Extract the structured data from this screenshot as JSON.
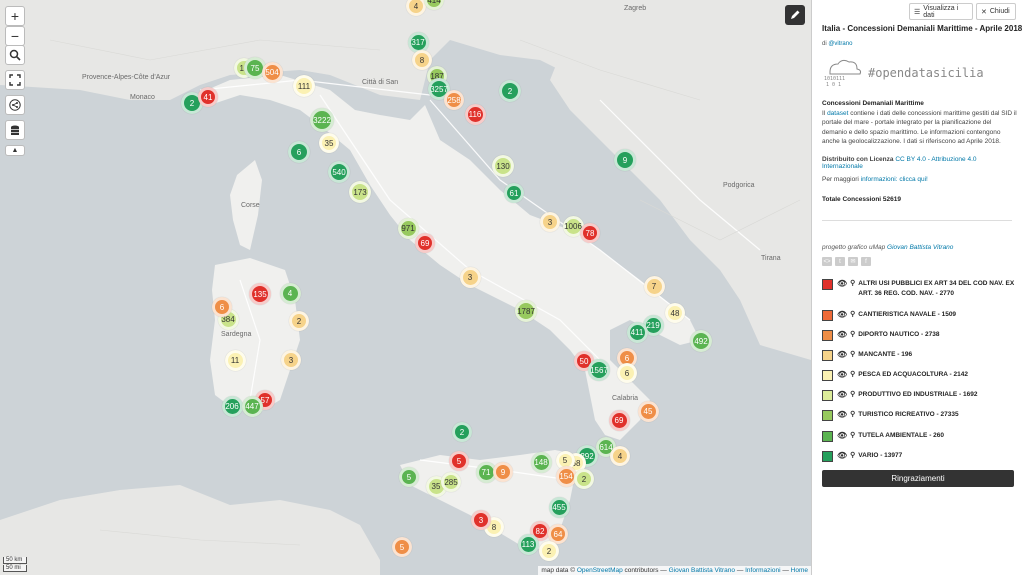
{
  "map": {
    "place_labels": [
      {
        "text": "Monaco"
      },
      {
        "text": "Città di San"
      },
      {
        "text": "Provence-Alpes-Côte d'Azur"
      },
      {
        "text": "Corse"
      },
      {
        "text": "Sardegna"
      },
      {
        "text": "Calabria"
      },
      {
        "text": "Podgorica"
      },
      {
        "text": "Tirana"
      },
      {
        "text": "Zagreb"
      }
    ],
    "clusters": [
      {
        "label": "4",
        "color": "#f6d38a",
        "dark": true
      },
      {
        "label": "414",
        "color": "#97c95e",
        "dark": true
      },
      {
        "label": "317",
        "color": "#25a05c"
      },
      {
        "label": "8",
        "color": "#f6d38a",
        "dark": true
      },
      {
        "label": "187",
        "color": "#97c95e",
        "dark": true
      },
      {
        "label": "3257",
        "color": "#25a05c"
      },
      {
        "label": "258",
        "color": "#ef8e47"
      },
      {
        "label": "116",
        "color": "#e0312b"
      },
      {
        "label": "2",
        "color": "#25a05c"
      },
      {
        "label": "9",
        "color": "#25a05c"
      },
      {
        "label": "10",
        "color": "#c9e38a",
        "dark": true
      },
      {
        "label": "75",
        "color": "#5bb451"
      },
      {
        "label": "504",
        "color": "#ef8e47"
      },
      {
        "label": "111",
        "color": "#fbf1b3",
        "dark": true
      },
      {
        "label": "2",
        "color": "#25a05c"
      },
      {
        "label": "41",
        "color": "#e0312b"
      },
      {
        "label": "3222",
        "color": "#5bb451"
      },
      {
        "label": "6",
        "color": "#25a05c"
      },
      {
        "label": "35",
        "color": "#fbf1b3",
        "dark": true
      },
      {
        "label": "540",
        "color": "#25a05c"
      },
      {
        "label": "173",
        "color": "#c9e38a",
        "dark": true
      },
      {
        "label": "130",
        "color": "#c9e38a",
        "dark": true
      },
      {
        "label": "61",
        "color": "#25a05c"
      },
      {
        "label": "3",
        "color": "#f6d38a",
        "dark": true
      },
      {
        "label": "1006",
        "color": "#c9e38a",
        "dark": true
      },
      {
        "label": "78",
        "color": "#e0312b"
      },
      {
        "label": "971",
        "color": "#97c95e",
        "dark": true
      },
      {
        "label": "69",
        "color": "#e0312b"
      },
      {
        "label": "3",
        "color": "#f6d38a",
        "dark": true
      },
      {
        "label": "1787",
        "color": "#97c95e",
        "dark": true
      },
      {
        "label": "7",
        "color": "#f6d38a",
        "dark": true
      },
      {
        "label": "219",
        "color": "#25a05c"
      },
      {
        "label": "48",
        "color": "#fbf1b3",
        "dark": true
      },
      {
        "label": "411",
        "color": "#25a05c"
      },
      {
        "label": "492",
        "color": "#5bb451"
      },
      {
        "label": "50",
        "color": "#e0312b"
      },
      {
        "label": "6",
        "color": "#ef8e47"
      },
      {
        "label": "1567",
        "color": "#25a05c"
      },
      {
        "label": "6",
        "color": "#fbf1b3",
        "dark": true
      },
      {
        "label": "45",
        "color": "#ef8e47"
      },
      {
        "label": "69",
        "color": "#e0312b"
      },
      {
        "label": "135",
        "color": "#e0312b"
      },
      {
        "label": "4",
        "color": "#5bb451"
      },
      {
        "label": "384",
        "color": "#c9e38a",
        "dark": true
      },
      {
        "label": "6",
        "color": "#ef8e47"
      },
      {
        "label": "2",
        "color": "#f6d38a",
        "dark": true
      },
      {
        "label": "11",
        "color": "#fbf1b3",
        "dark": true
      },
      {
        "label": "3",
        "color": "#f6d38a",
        "dark": true
      },
      {
        "label": "57",
        "color": "#e0312b"
      },
      {
        "label": "206",
        "color": "#25a05c"
      },
      {
        "label": "447",
        "color": "#5bb451"
      },
      {
        "label": "2",
        "color": "#25a05c"
      },
      {
        "label": "614",
        "color": "#5bb451"
      },
      {
        "label": "292",
        "color": "#25a05c"
      },
      {
        "label": "4",
        "color": "#f6d38a",
        "dark": true
      },
      {
        "label": "148",
        "color": "#5bb451"
      },
      {
        "label": "68",
        "color": "#fbf1b3",
        "dark": true
      },
      {
        "label": "5",
        "color": "#fbf1b3",
        "dark": true
      },
      {
        "label": "154",
        "color": "#ef8e47"
      },
      {
        "label": "2",
        "color": "#c9e38a",
        "dark": true
      },
      {
        "label": "71",
        "color": "#5bb451"
      },
      {
        "label": "9",
        "color": "#ef8e47"
      },
      {
        "label": "5",
        "color": "#5bb451"
      },
      {
        "label": "35",
        "color": "#c9e38a",
        "dark": true
      },
      {
        "label": "285",
        "color": "#c9e38a",
        "dark": true
      },
      {
        "label": "455",
        "color": "#25a05c"
      },
      {
        "label": "8",
        "color": "#fbf1b3",
        "dark": true
      },
      {
        "label": "3",
        "color": "#e0312b"
      },
      {
        "label": "82",
        "color": "#e0312b"
      },
      {
        "label": "64",
        "color": "#ef8e47"
      },
      {
        "label": "113",
        "color": "#25a05c"
      },
      {
        "label": "2",
        "color": "#fbf1b3",
        "dark": true
      },
      {
        "label": "5",
        "color": "#ef8e47"
      },
      {
        "label": "5",
        "color": "#e0312b"
      }
    ],
    "scale_labels": [
      "50 km",
      "50 mi"
    ],
    "attribution": {
      "prefix": "map data ©",
      "osm": "OpenStreetMap",
      "contrib": "contributors —",
      "author": "Giovan Battista Vitrano",
      "sep": "—",
      "info": "Informazioni",
      "home": "Home"
    }
  },
  "panel": {
    "view_data_btn": "Visualizza i dati",
    "close_btn": "Chiudi",
    "title": "Italia - Concessioni Demaniali Marittime - Aprile 2018",
    "by_prefix": "di",
    "by_user": "@vitrano",
    "logo_text": "#opendatasicilia",
    "desc_heading": "Concessioni Demaniali Marittime",
    "desc_p1": "Il",
    "desc_link": "dataset",
    "desc_p2": "contiene i dati delle concessioni marittime gestiti dal SID il portale del mare - portale integrato per la pianificazione del demanio e dello spazio marittimo. Le informazioni contengono anche la geolocalizzazione. I dati si riferiscono ad Aprile 2018.",
    "license_label": "Distribuito con Licenza",
    "license_link": "CC BY 4.0 - Attribuzione 4.0 Internazionale",
    "more_info_prefix": "Per maggiori",
    "more_info_link": "informazioni: clicca qui!",
    "total": "Totale Concessioni 52619",
    "credit_prefix": "progetto grafico uMap",
    "credit_link": "Giovan Battista Vitrano",
    "legend": [
      {
        "label": "ALTRI USI PUBBLICI EX ART 34 DEL COD NAV. EX ART. 36 REG. COD. NAV. - 2770",
        "color": "#e0312b"
      },
      {
        "label": "CANTIERISTICA NAVALE - 1509",
        "color": "#ee6a38"
      },
      {
        "label": "DIPORTO NAUTICO - 2738",
        "color": "#ef8e47"
      },
      {
        "label": "MANCANTE - 196",
        "color": "#f6d38a"
      },
      {
        "label": "PESCA ED ACQUACOLTURA - 2142",
        "color": "#fbf1b3"
      },
      {
        "label": "PRODUTTIVO ED INDUSTRIALE - 1692",
        "color": "#dcec9a"
      },
      {
        "label": "TURISTICO RICREATIVO - 27335",
        "color": "#97c95e"
      },
      {
        "label": "TUTELA AMBIENTALE - 260",
        "color": "#5bb451"
      },
      {
        "label": "VARIO - 13977",
        "color": "#25a05c"
      }
    ],
    "thanks_btn": "Ringraziamenti"
  }
}
